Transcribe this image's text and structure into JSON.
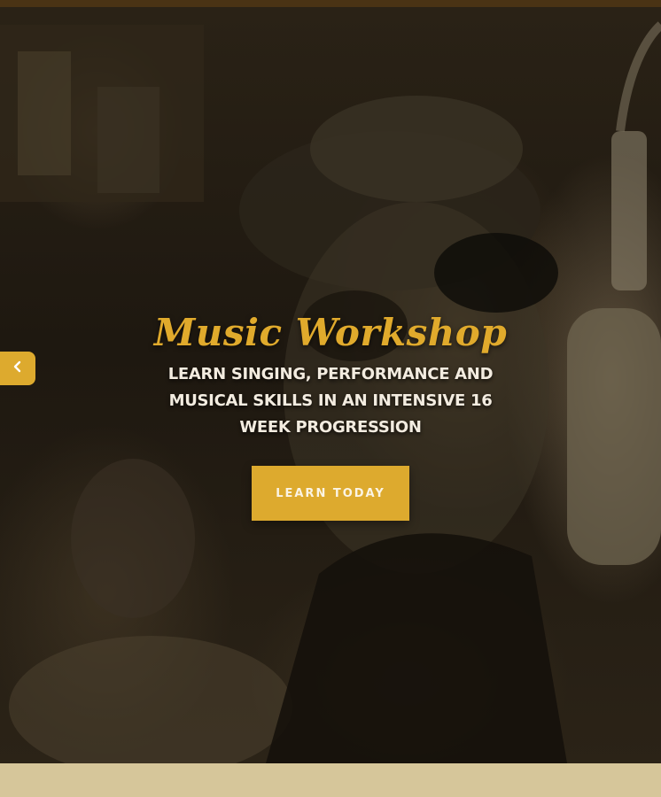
{
  "hero": {
    "title": "Music Workshop",
    "subtitle": "LEARN SINGING, PERFORMANCE AND MUSICAL SKILLS IN AN INTENSIVE 16 WEEK PROGRESSION",
    "cta_label": "LEARN TODAY",
    "background": "sepia-studio-photo-singer-microphone"
  },
  "slider": {
    "prev_icon": "chevron-left-icon"
  },
  "colors": {
    "accent": "#ddaa2e",
    "top_bar": "#4a3314",
    "bottom_band": "#d6c69a",
    "subtitle_text": "#f3ece0"
  }
}
